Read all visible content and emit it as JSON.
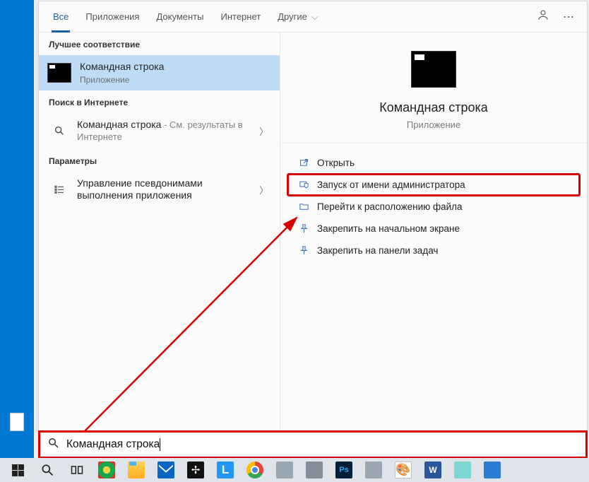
{
  "filters": {
    "items": [
      "Все",
      "Приложения",
      "Документы",
      "Интернет",
      "Другие"
    ],
    "active_index": 0
  },
  "sections": {
    "best_match": "Лучшее соответствие",
    "web": "Поиск в Интернете",
    "settings": "Параметры"
  },
  "results": {
    "best": {
      "title": "Командная строка",
      "subtitle": "Приложение"
    },
    "web": {
      "title": "Командная строка",
      "subtitle_prefix": " - ",
      "subtitle": "См. результаты в Интернете"
    },
    "settings": {
      "title": "Управление псевдонимами выполнения приложения"
    }
  },
  "preview": {
    "title": "Командная строка",
    "subtitle": "Приложение",
    "actions": [
      {
        "label": "Открыть",
        "icon": "open"
      },
      {
        "label": "Запуск от имени администратора",
        "icon": "admin",
        "boxed": true
      },
      {
        "label": "Перейти к расположению файла",
        "icon": "location"
      },
      {
        "label": "Закрепить на начальном экране",
        "icon": "pin-start"
      },
      {
        "label": "Закрепить на панели задач",
        "icon": "pin-task"
      }
    ]
  },
  "search": {
    "value": "Командная строка"
  },
  "taskbar": {
    "apps": [
      {
        "name": "start",
        "color": "#222"
      },
      {
        "name": "search",
        "color": "#222"
      },
      {
        "name": "taskview",
        "color": "#222"
      },
      {
        "name": "browser-1",
        "color": "#1aa84d"
      },
      {
        "name": "explorer",
        "color": "#ffcc33"
      },
      {
        "name": "mail",
        "color": "#0a66c2"
      },
      {
        "name": "launcher",
        "color": "#202020"
      },
      {
        "name": "app-l",
        "color": "#2196f3"
      },
      {
        "name": "chrome",
        "color": "#ffffff"
      },
      {
        "name": "device-1",
        "color": "#9aa6b2"
      },
      {
        "name": "device-2",
        "color": "#9aa6b2"
      },
      {
        "name": "photoshop",
        "color": "#001e36"
      },
      {
        "name": "device-3",
        "color": "#9aa6b2"
      },
      {
        "name": "paint",
        "color": "#ffffff"
      },
      {
        "name": "word",
        "color": "#2b579a"
      },
      {
        "name": "note",
        "color": "#7fd6d0"
      },
      {
        "name": "app-x",
        "color": "#2a7bd1"
      }
    ]
  }
}
